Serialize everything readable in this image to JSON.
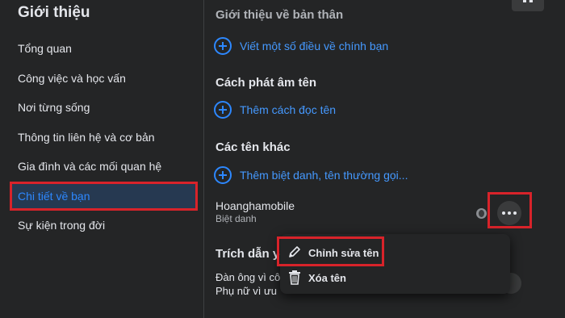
{
  "sidebar": {
    "title": "Giới thiệu",
    "items": [
      {
        "label": "Tổng quan"
      },
      {
        "label": "Công việc và học vấn"
      },
      {
        "label": "Nơi từng sống"
      },
      {
        "label": "Thông tin liên hệ và cơ bản"
      },
      {
        "label": "Gia đình và các mối quan hệ"
      },
      {
        "label": "Chi tiết về bạn"
      },
      {
        "label": "Sự kiện trong đời"
      }
    ],
    "active_index": 5
  },
  "main": {
    "about_section_title": "Giới thiệu về bản thân",
    "about_add": "Viết một số điều về chính bạn",
    "pronunciation_title": "Cách phát âm tên",
    "pronunciation_add": "Thêm cách đọc tên",
    "other_names_title": "Các tên khác",
    "other_names_add": "Thêm biệt danh, tên thường gọi...",
    "nickname": {
      "name": "Hoanghamobile",
      "type": "Biệt danh"
    },
    "quote_title": "Trích dẫn yê",
    "quote_lines": [
      "Đàn ông vì cô",
      "Phụ nữ vì ưu"
    ]
  },
  "menu": {
    "edit_label": "Chỉnh sửa tên",
    "delete_label": "Xóa tên"
  },
  "icons": [
    "plus-circle-icon",
    "globe-icon",
    "more-icon",
    "pencil-icon",
    "trash-icon"
  ],
  "colors": {
    "accent": "#2d88ff",
    "highlight": "#d8232a",
    "active_bg": "#263951"
  }
}
